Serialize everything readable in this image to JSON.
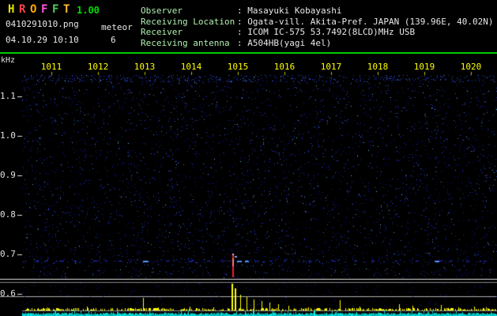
{
  "header": {
    "logo": {
      "letters": [
        {
          "ch": "H",
          "color": "#e8e800"
        },
        {
          "ch": "R",
          "color": "#ff4444"
        },
        {
          "ch": "O",
          "color": "#ffaa00"
        },
        {
          "ch": "F",
          "color": "#ff55dd"
        },
        {
          "ch": "F",
          "color": "#55cc55"
        },
        {
          "ch": "T",
          "color": "#ffbb33"
        }
      ],
      "version": "1.00"
    },
    "filename": "0410291010.png",
    "mode": "meteor",
    "datetime": "04.10.29 10:10",
    "count": "6",
    "info": [
      {
        "label": "Observer",
        "value": ": Masayuki Kobayashi"
      },
      {
        "label": "Receiving Location",
        "value": ": Ogata-vill. Akita-Pref. JAPAN (139.96E, 40.02N)"
      },
      {
        "label": "Receiver",
        "value": ": ICOM IC-575 53.7492(8LCD)MHz USB"
      },
      {
        "label": "Receiving antenna",
        "value": ": A504HB(yagi 4el)"
      }
    ]
  },
  "axes": {
    "y_unit": "kHz"
  },
  "chart_data": {
    "type": "heatmap",
    "title": "HROFFT meteor-echo spectrogram with signal-level trace",
    "time_ticks": [
      "1011",
      "1012",
      "1013",
      "1014",
      "1015",
      "1016",
      "1017",
      "1018",
      "1019",
      "1020"
    ],
    "freq_ticks_khz": [
      "1.1",
      "1.0",
      "0.9",
      "0.8",
      "0.7",
      "0.6"
    ],
    "freq_unit": "kHz",
    "background_noise": {
      "density": 0.024
    },
    "carrier": {
      "freq_khz": 0.7,
      "color": "#2233dd",
      "bright_color": "#5599ff",
      "dashes": [
        {
          "x": 0.028,
          "l": 4,
          "b": 0
        },
        {
          "x": 0.048,
          "l": 3,
          "b": 0
        },
        {
          "x": 0.078,
          "l": 5,
          "b": 0
        },
        {
          "x": 0.108,
          "l": 4,
          "b": 0
        },
        {
          "x": 0.15,
          "l": 6,
          "b": 0
        },
        {
          "x": 0.175,
          "l": 3,
          "b": 0
        },
        {
          "x": 0.203,
          "l": 4,
          "b": 0
        },
        {
          "x": 0.254,
          "l": 7,
          "b": 1
        },
        {
          "x": 0.303,
          "l": 4,
          "b": 0
        },
        {
          "x": 0.352,
          "l": 5,
          "b": 0
        },
        {
          "x": 0.39,
          "l": 4,
          "b": 0
        },
        {
          "x": 0.42,
          "l": 3,
          "b": 0
        },
        {
          "x": 0.452,
          "l": 6,
          "b": 1
        },
        {
          "x": 0.47,
          "l": 5,
          "b": 1
        },
        {
          "x": 0.49,
          "l": 4,
          "b": 0
        },
        {
          "x": 0.52,
          "l": 4,
          "b": 0
        },
        {
          "x": 0.55,
          "l": 3,
          "b": 0
        },
        {
          "x": 0.602,
          "l": 4,
          "b": 0
        },
        {
          "x": 0.652,
          "l": 4,
          "b": 0
        },
        {
          "x": 0.7,
          "l": 3,
          "b": 0
        },
        {
          "x": 0.735,
          "l": 4,
          "b": 0
        },
        {
          "x": 0.785,
          "l": 3,
          "b": 0
        },
        {
          "x": 0.828,
          "l": 4,
          "b": 0
        },
        {
          "x": 0.868,
          "l": 6,
          "b": 1
        },
        {
          "x": 0.878,
          "l": 4,
          "b": 0
        },
        {
          "x": 0.902,
          "l": 3,
          "b": 0
        },
        {
          "x": 0.935,
          "l": 4,
          "b": 0
        },
        {
          "x": 0.972,
          "l": 4,
          "b": 0
        }
      ]
    },
    "meteor_echo": {
      "time_tick": "1014.9",
      "x_frac": 0.4426,
      "freq_top_khz": 0.72,
      "freq_bottom_khz": 0.66,
      "color": "#ee2222"
    },
    "power_trace": {
      "color": "#ffff00",
      "baseline_color": "#8a8a8a",
      "ref_line_colors": [
        "#e0e0e0",
        "#8a8a8a",
        "#b0b0b0"
      ],
      "noise_band_color": "#00c4c4",
      "spikes": [
        {
          "x": 0.02,
          "h": 0.08
        },
        {
          "x": 0.053,
          "h": 0.1
        },
        {
          "x": 0.095,
          "h": 0.08
        },
        {
          "x": 0.136,
          "h": 0.12
        },
        {
          "x": 0.186,
          "h": 0.08
        },
        {
          "x": 0.2546,
          "h": 0.4
        },
        {
          "x": 0.286,
          "h": 0.1
        },
        {
          "x": 0.353,
          "h": 0.12
        },
        {
          "x": 0.403,
          "h": 0.1
        },
        {
          "x": 0.441,
          "h": 0.85
        },
        {
          "x": 0.4476,
          "h": 0.7
        },
        {
          "x": 0.459,
          "h": 0.5
        },
        {
          "x": 0.4726,
          "h": 0.42
        },
        {
          "x": 0.4876,
          "h": 0.35
        },
        {
          "x": 0.504,
          "h": 0.3
        },
        {
          "x": 0.521,
          "h": 0.25
        },
        {
          "x": 0.539,
          "h": 0.2
        },
        {
          "x": 0.561,
          "h": 0.15
        },
        {
          "x": 0.602,
          "h": 0.1
        },
        {
          "x": 0.669,
          "h": 0.32
        },
        {
          "x": 0.71,
          "h": 0.12
        },
        {
          "x": 0.794,
          "h": 0.2
        },
        {
          "x": 0.822,
          "h": 0.15
        },
        {
          "x": 0.882,
          "h": 0.18
        },
        {
          "x": 0.918,
          "h": 0.1
        },
        {
          "x": 0.952,
          "h": 0.12
        },
        {
          "x": 0.977,
          "h": 0.1
        }
      ]
    }
  }
}
